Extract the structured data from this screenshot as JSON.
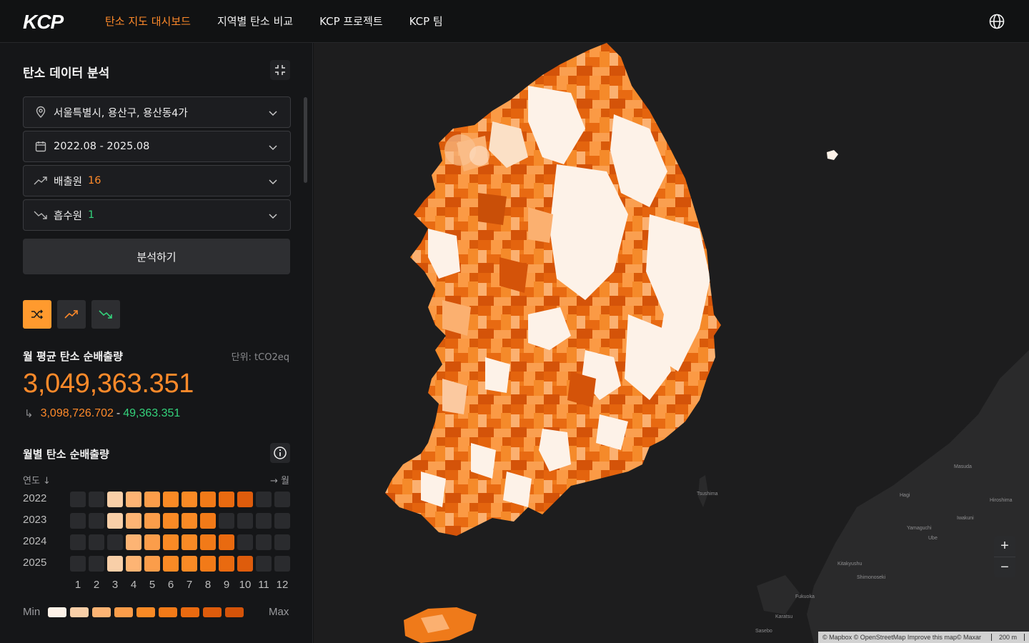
{
  "header": {
    "logo": "KCP",
    "nav": [
      {
        "label": "탄소 지도 대시보드",
        "active": true
      },
      {
        "label": "지역별 탄소 비교",
        "active": false
      },
      {
        "label": "KCP 프로젝트",
        "active": false
      },
      {
        "label": "KCP 팀",
        "active": false
      }
    ],
    "language_icon": "globe-icon"
  },
  "sidebar": {
    "title": "탄소 데이터 분석",
    "collapse_icon": "collapse-icon",
    "location": {
      "value": "서울특별시, 용산구, 용산동4가",
      "icon": "map-pin-icon"
    },
    "period": {
      "value": "2022.08 - 2025.08",
      "icon": "calendar-icon"
    },
    "emission_sources": {
      "label": "배출원",
      "count": "16",
      "icon": "trend-up-icon"
    },
    "absorption_sources": {
      "label": "흡수원",
      "count": "1",
      "icon": "trend-down-icon"
    },
    "analyze_button": "분석하기",
    "modes": [
      {
        "icon": "shuffle-icon",
        "active": true
      },
      {
        "icon": "trend-up-icon",
        "active": false
      },
      {
        "icon": "trend-down-icon",
        "active": false
      }
    ],
    "avg": {
      "label": "월 평균 탄소 순배출량",
      "unit": "단위: tCO2eq",
      "value": "3,049,363.351",
      "emission": "3,098,726.702",
      "separator": "-",
      "absorption": "49,363.351"
    },
    "monthly": {
      "title": "월별 탄소 순배출량",
      "year_axis": "연도 ↓",
      "month_axis": "→ 월",
      "years": [
        "2022",
        "2023",
        "2024",
        "2025"
      ],
      "months": [
        "1",
        "2",
        "3",
        "4",
        "5",
        "6",
        "7",
        "8",
        "9",
        "10",
        "11",
        "12"
      ],
      "levels": [
        [
          0,
          0,
          2,
          3,
          4,
          5,
          5,
          6,
          7,
          8,
          0,
          0
        ],
        [
          0,
          0,
          2,
          3,
          4,
          5,
          5,
          6,
          0,
          0,
          0,
          0
        ],
        [
          0,
          0,
          0,
          3,
          4,
          5,
          5,
          6,
          7,
          0,
          0,
          0
        ],
        [
          0,
          0,
          2,
          3,
          4,
          5,
          5,
          6,
          7,
          8,
          0,
          0
        ]
      ],
      "legend_min": "Min",
      "legend_max": "Max"
    }
  },
  "map": {
    "zoom_in": "+",
    "zoom_out": "−",
    "attribution": "© Mapbox © OpenStreetMap Improve this map© Maxar",
    "scale": "200 m",
    "place_labels": [
      "Hiroshima",
      "Fukuoka",
      "Yamaguchi",
      "Kitakyushu",
      "Shimonoseki",
      "Hagi",
      "Masuda",
      "Iwakuni",
      "Ube",
      "Karatsu",
      "Sasebo",
      "Tsushima"
    ]
  },
  "colors": {
    "accent": "#ff8a2a",
    "green": "#34d27b",
    "scale": [
      "#2a2b2e",
      "#fdf2e8",
      "#f8cfa8",
      "#fdb474",
      "#fb9d4a",
      "#f98a25",
      "#f27a18",
      "#e96a10",
      "#de5c0c",
      "#d45309"
    ]
  }
}
